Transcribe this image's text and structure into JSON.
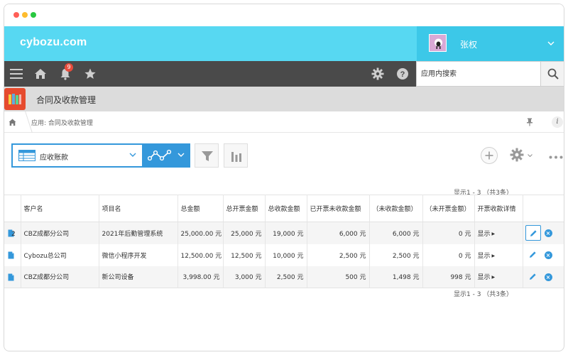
{
  "window": {
    "controls": [
      "close",
      "minimize",
      "maximize"
    ]
  },
  "header": {
    "logo": "cybozu.com",
    "user_name": "张权",
    "colors": {
      "bar": "#57d8f2",
      "user_area": "#3cc8e8"
    }
  },
  "navbar": {
    "notification_count": "9",
    "search_placeholder": "应用内搜索"
  },
  "app": {
    "title": "合同及收款管理"
  },
  "breadcrumb": {
    "text": "应用: 合同及收款管理"
  },
  "view": {
    "selected": "应收账款"
  },
  "pagination": {
    "top": "显示1 - 3 （共3条）",
    "bottom": "显示1 - 3 （共3条）"
  },
  "table": {
    "columns": [
      "客户名",
      "项目名",
      "总金额",
      "总开票金额",
      "总收款金额",
      "已开票未收款金额",
      "（未收款金额）",
      "（未开票金额）",
      "开票收款详情"
    ],
    "rows": [
      {
        "stack_count": "2",
        "cells": [
          "CBZ成都分公司",
          "2021年后勤管理系统",
          "25,000.00 元",
          "25,000 元",
          "19,000 元",
          "6,000 元",
          "6,000 元",
          "0 元",
          "显示"
        ]
      },
      {
        "stack_count": "",
        "cells": [
          "Cybozu总公司",
          "微信小程序开发",
          "12,500.00 元",
          "12,500 元",
          "10,000 元",
          "2,500 元",
          "2,500 元",
          "0 元",
          "显示"
        ]
      },
      {
        "stack_count": "",
        "cells": [
          "CBZ成都分公司",
          "新公司设备",
          "3,998.00 元",
          "3,000 元",
          "2,500 元",
          "500 元",
          "1,498 元",
          "998 元",
          "显示"
        ]
      }
    ]
  },
  "icons": [
    "menu-icon",
    "home-icon",
    "bell-icon",
    "star-icon",
    "gear-icon",
    "help-icon",
    "search-icon",
    "pin-icon",
    "info-icon",
    "list-view-icon",
    "graph-icon",
    "filter-icon",
    "bar-chart-icon",
    "plus-icon",
    "more-icon",
    "edit-icon",
    "delete-icon",
    "document-icon"
  ]
}
